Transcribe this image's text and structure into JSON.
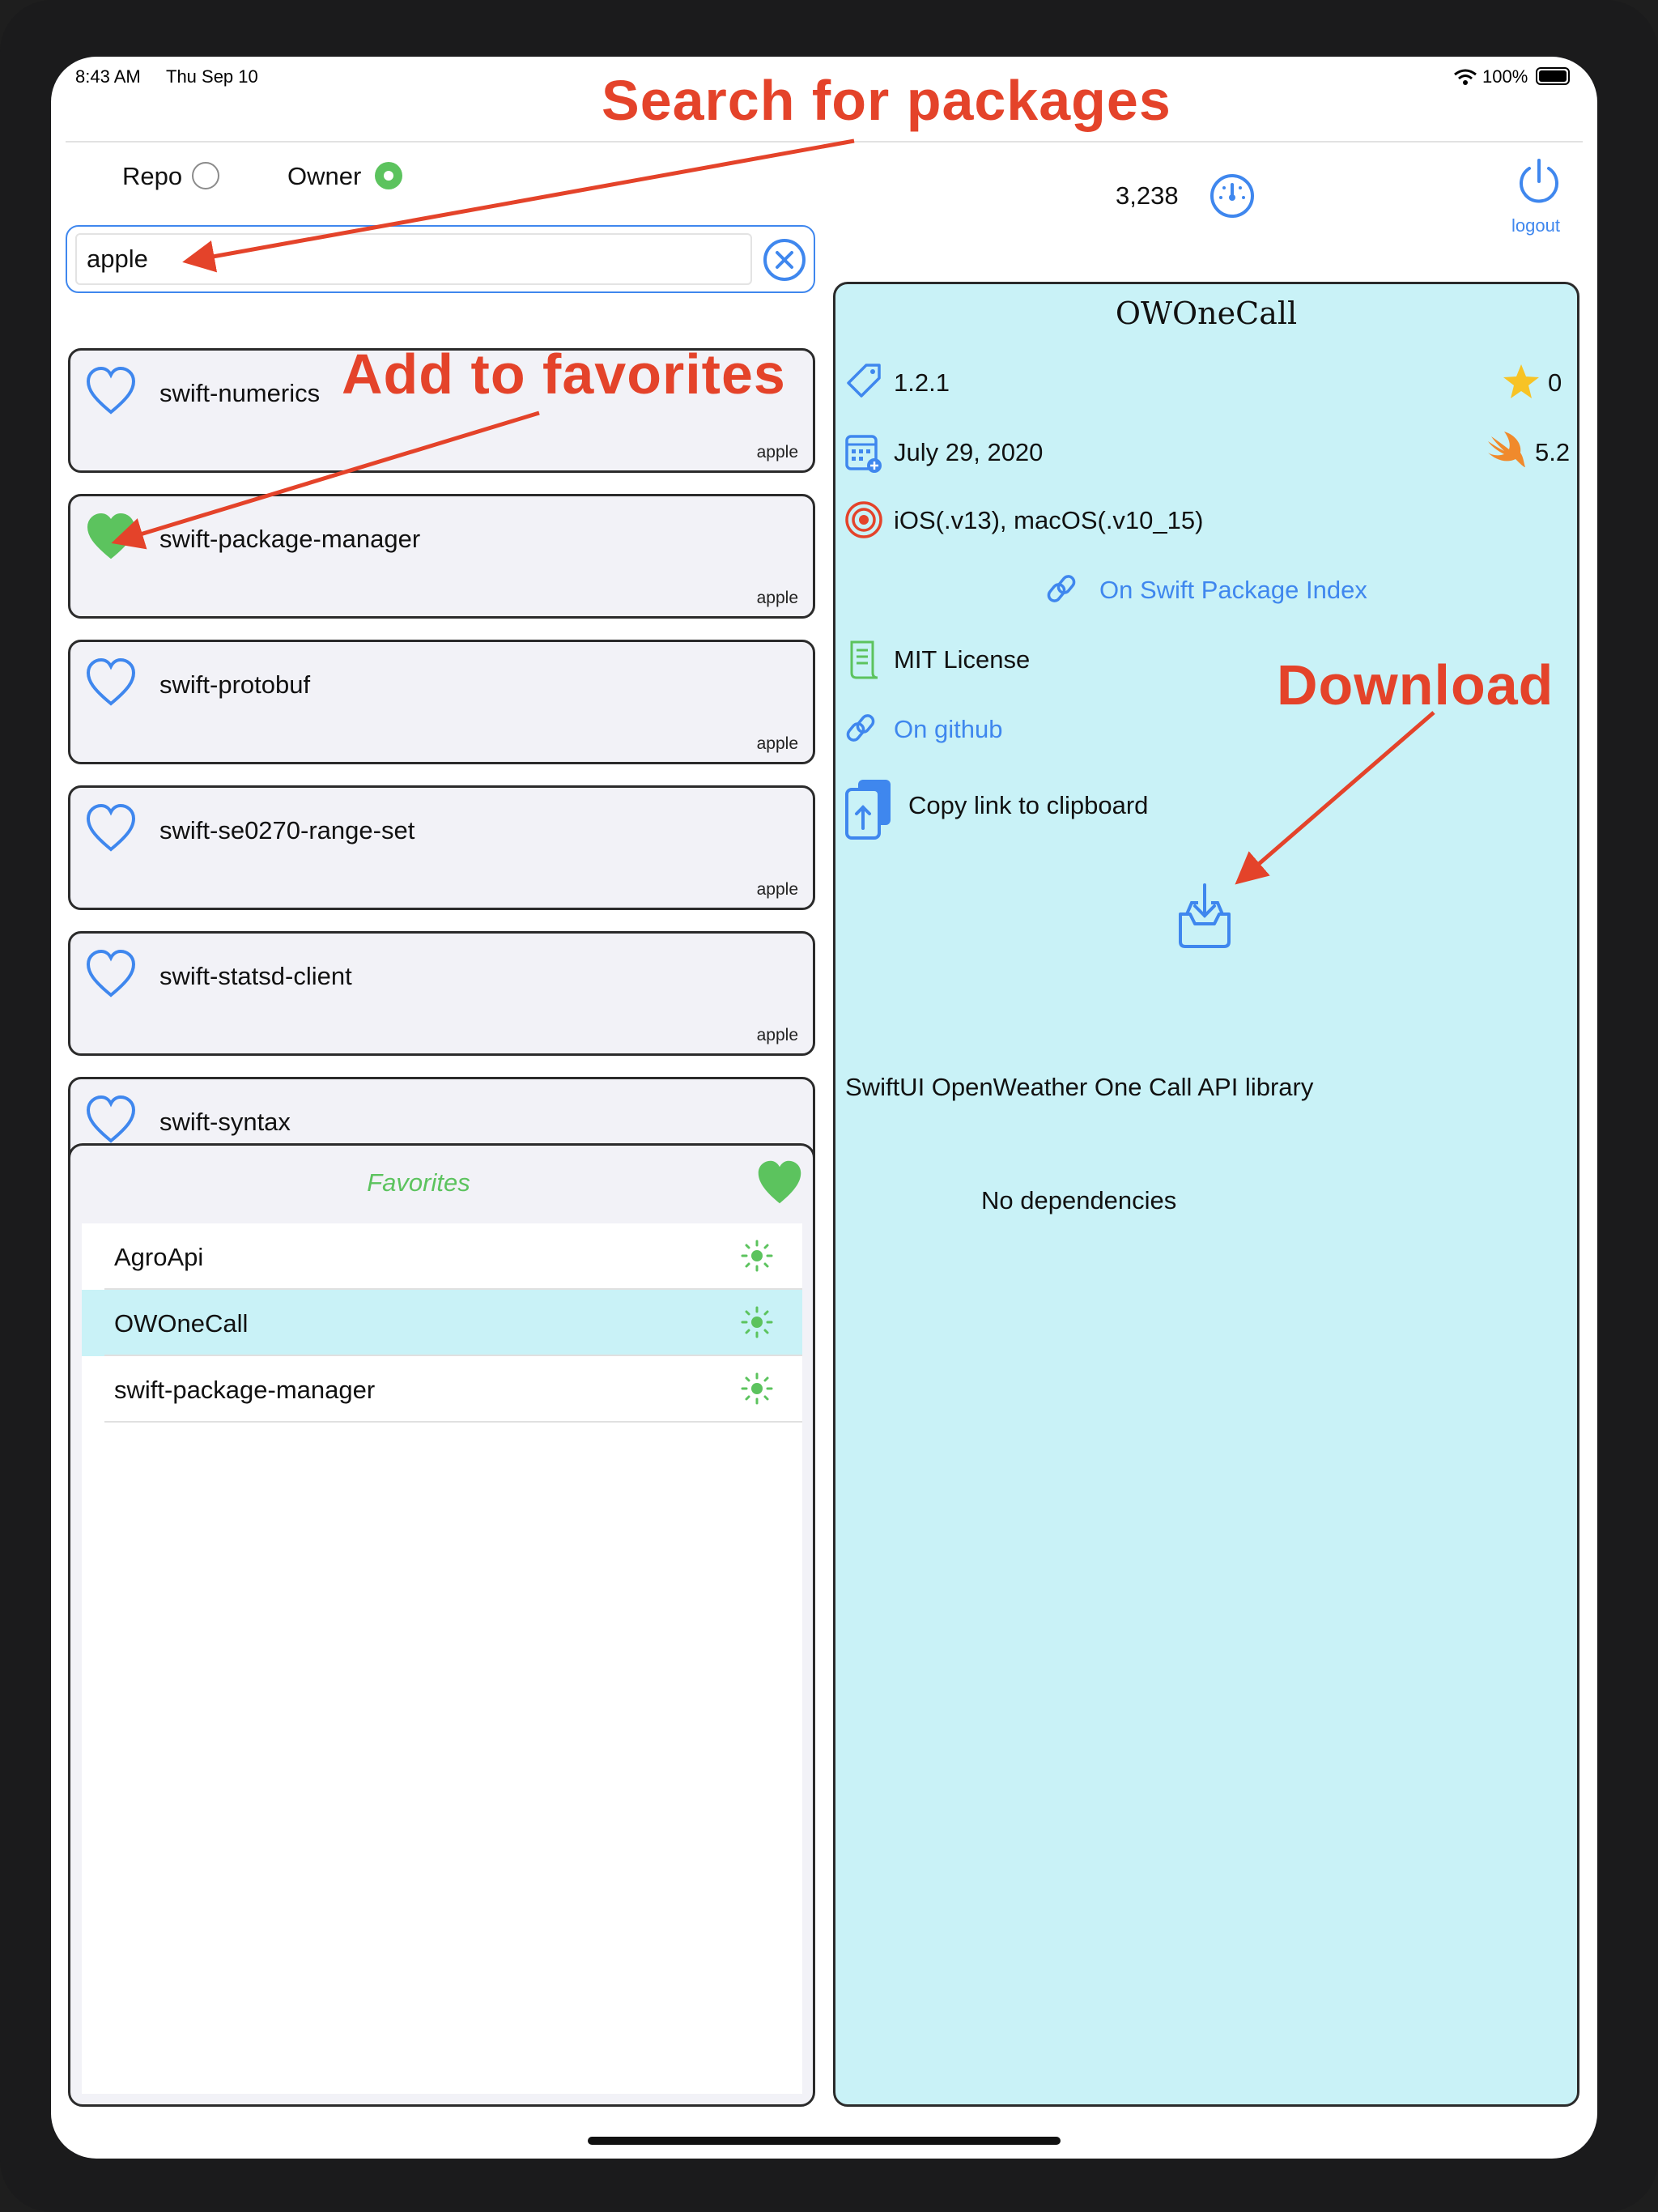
{
  "status_bar": {
    "time": "8:43 AM",
    "date": "Thu Sep 10",
    "battery": "100%"
  },
  "search_mode": {
    "repo_label": "Repo",
    "owner_label": "Owner",
    "selected": "Owner"
  },
  "search": {
    "value": "apple"
  },
  "counter": {
    "value": "3,238"
  },
  "logout": {
    "label": "logout"
  },
  "results": [
    {
      "name": "swift-numerics",
      "owner": "apple",
      "favorite": false
    },
    {
      "name": "swift-package-manager",
      "owner": "apple",
      "favorite": true
    },
    {
      "name": "swift-protobuf",
      "owner": "apple",
      "favorite": false
    },
    {
      "name": "swift-se0270-range-set",
      "owner": "apple",
      "favorite": false
    },
    {
      "name": "swift-statsd-client",
      "owner": "apple",
      "favorite": false
    },
    {
      "name": "swift-syntax",
      "owner": "apple",
      "favorite": false
    }
  ],
  "favorites": {
    "title": "Favorites",
    "items": [
      {
        "name": "AgroApi",
        "selected": false
      },
      {
        "name": "OWOneCall",
        "selected": true
      },
      {
        "name": "swift-package-manager",
        "selected": false
      }
    ]
  },
  "detail": {
    "title": "OWOneCall",
    "version": "1.2.1",
    "stars": "0",
    "date": "July 29, 2020",
    "swift_version": "5.2",
    "platforms": "iOS(.v13), macOS(.v10_15)",
    "swift_package_index": "On Swift Package Index",
    "license": "MIT License",
    "github": "On github",
    "copy_link": "Copy link to clipboard",
    "description": "SwiftUI OpenWeather One Call API library",
    "dependencies": "No dependencies"
  },
  "annotations": {
    "search": "Search for packages",
    "favorites": "Add to favorites",
    "download": "Download"
  },
  "colors": {
    "accent": "#3f87ee",
    "favorite_green": "#5cc35e",
    "detail_bg": "#c9f2f7",
    "annotation_red": "#e4432a",
    "star": "#f7c325",
    "swift_orange": "#f08a2c"
  }
}
